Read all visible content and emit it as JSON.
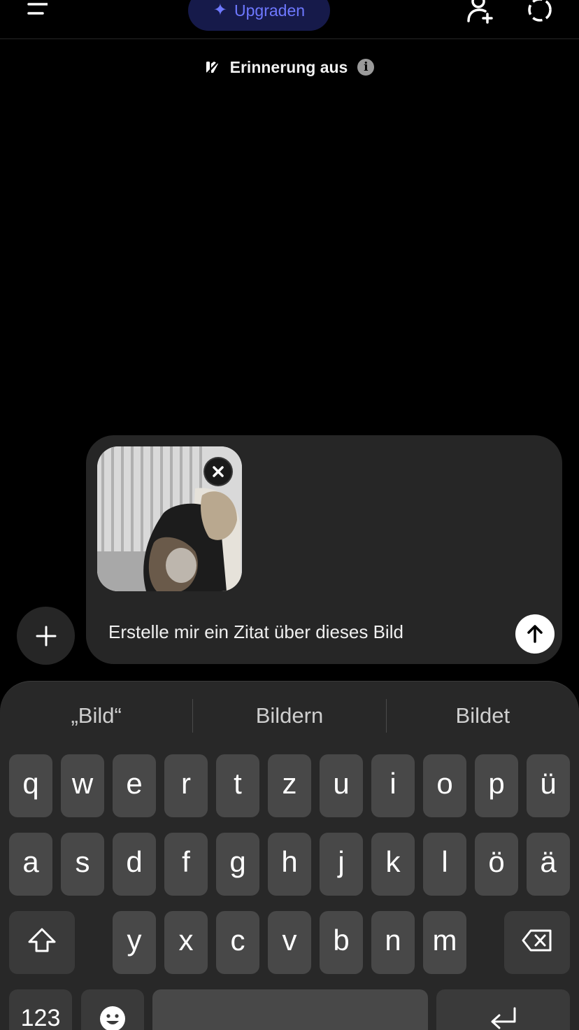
{
  "header": {
    "menu_icon": "menu-icon",
    "upgrade_label": "Upgraden",
    "upgrade_icon": "sparkle-icon",
    "add_user_icon": "add-user-icon",
    "temporary_chat_icon": "temporary-chat-icon",
    "accent": "#6e78ff"
  },
  "memory": {
    "label": "Erinnerung aus",
    "icon": "memory-off-icon",
    "info_icon": "info-icon",
    "info_glyph": "i"
  },
  "composer": {
    "attachment_icon": "image-attachment",
    "remove_icon": "close-icon",
    "prompt_text": "Erstelle mir ein Zitat über dieses Bild",
    "send_icon": "arrow-up-icon",
    "plus_icon": "plus-icon"
  },
  "keyboard": {
    "suggestions": [
      "„Bild“",
      "Bildern",
      "Bildet"
    ],
    "row1": [
      "q",
      "w",
      "e",
      "r",
      "t",
      "z",
      "u",
      "i",
      "o",
      "p",
      "ü"
    ],
    "row2": [
      "a",
      "s",
      "d",
      "f",
      "g",
      "h",
      "j",
      "k",
      "l",
      "ö",
      "ä"
    ],
    "row3": [
      "y",
      "x",
      "c",
      "v",
      "b",
      "n",
      "m"
    ],
    "shift_icon": "shift-icon",
    "backspace_icon": "backspace-icon",
    "numbers_label": "123",
    "emoji_icon": "emoji-icon",
    "return_icon": "return-icon"
  }
}
